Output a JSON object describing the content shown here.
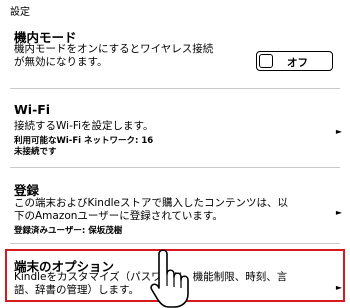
{
  "header": {
    "title": "設定"
  },
  "airplane": {
    "title": "機内モード",
    "desc_line1": "機内モードをオンにするとワイヤレス接続",
    "desc_line2": "が無効になります。",
    "toggle_label": "オフ"
  },
  "wifi": {
    "title": "Wi-Fi",
    "desc": "接続するWi-Fiを設定します。",
    "networks": "利用可能なWi-Fi ネットワーク: 16",
    "status": "未接続です",
    "arrow": "►"
  },
  "registration": {
    "title": "登録",
    "desc_line1": "この端末およびKindleストアで購入したコンテンツは、以",
    "desc_line2": "下のAmazonユーザーに登録されています。",
    "user": "登録済みユーザー: 保坂茂樹",
    "arrow": "►"
  },
  "device_options": {
    "title": "端末のオプション",
    "desc_line1": "Kindleをカスタマイズ（パスワード、機能制限、時刻、言",
    "desc_line2": "語、辞書の管理）します。",
    "arrow": "►"
  },
  "colors": {
    "highlight": "#d71920"
  },
  "icons": {
    "pointer": "hand-pointer-icon"
  }
}
